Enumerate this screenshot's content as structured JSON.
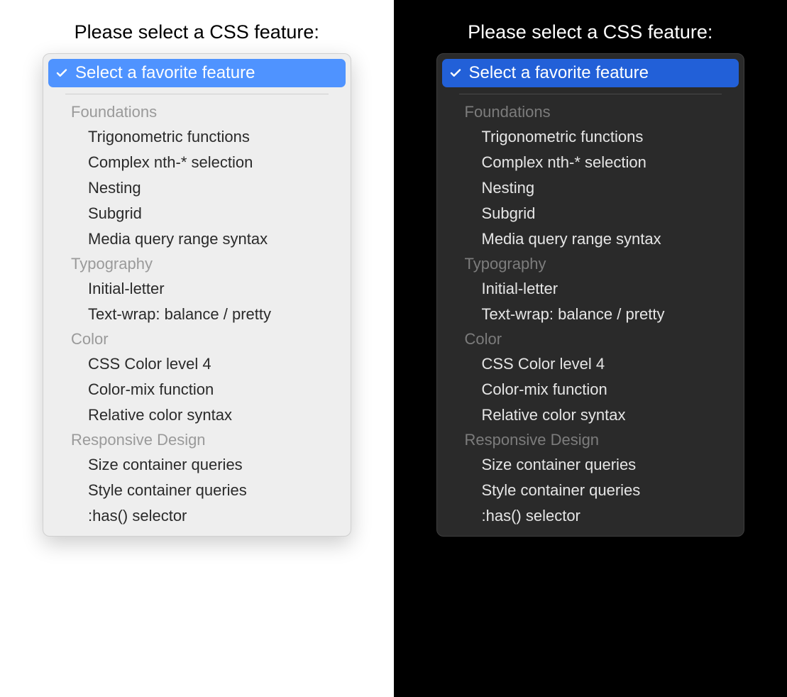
{
  "prompt": "Please select a CSS feature:",
  "selected_label": "Select a favorite feature",
  "colors": {
    "light_bg": "#ffffff",
    "dark_bg": "#000000",
    "light_dropdown_bg": "#eeeeee",
    "dark_dropdown_bg": "#2a2a2a",
    "light_highlight": "#4f93ff",
    "dark_highlight": "#2260d8"
  },
  "groups": [
    {
      "label": "Foundations",
      "options": [
        "Trigonometric functions",
        "Complex nth-* selection",
        "Nesting",
        "Subgrid",
        "Media query range syntax"
      ]
    },
    {
      "label": "Typography",
      "options": [
        "Initial-letter",
        "Text-wrap: balance / pretty"
      ]
    },
    {
      "label": "Color",
      "options": [
        "CSS Color level 4",
        "Color-mix function",
        "Relative color syntax"
      ]
    },
    {
      "label": "Responsive Design",
      "options": [
        "Size container queries",
        "Style container queries",
        ":has() selector"
      ]
    }
  ]
}
